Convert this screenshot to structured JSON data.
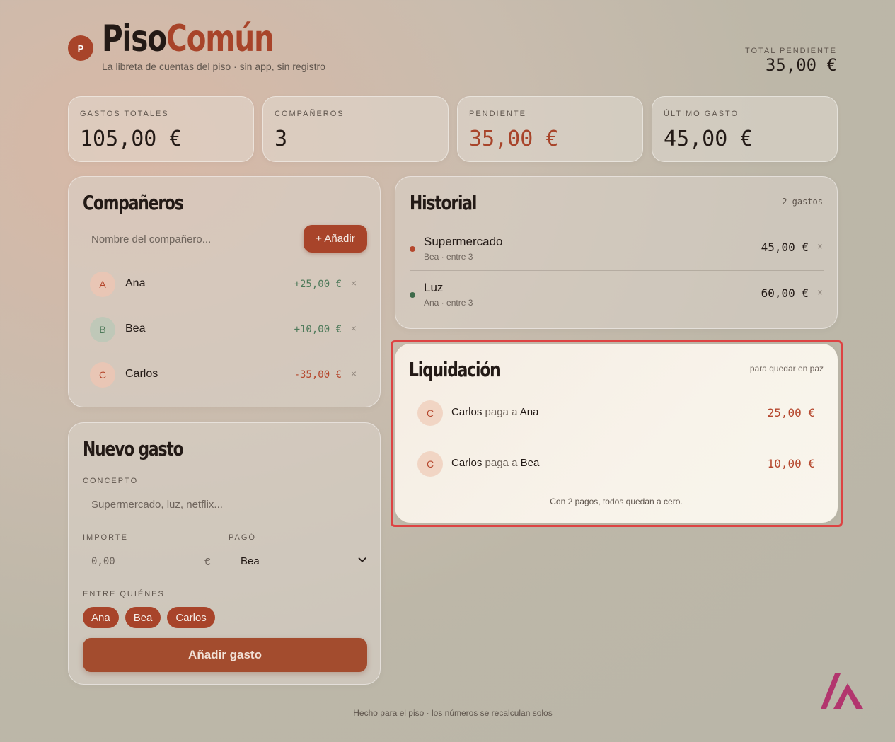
{
  "brand": {
    "part1": "Piso",
    "part2": "Común",
    "badge": "P",
    "tagline": "La libreta de cuentas del piso · sin app, sin registro"
  },
  "header_total": {
    "label": "TOTAL PENDIENTE",
    "value": "35,00 €"
  },
  "stats": [
    {
      "label": "GASTOS TOTALES",
      "value": "105,00 €"
    },
    {
      "label": "COMPAÑEROS",
      "value": "3"
    },
    {
      "label": "PENDIENTE",
      "value": "35,00 €"
    },
    {
      "label": "ÚLTIMO GASTO",
      "value": "45,00 €"
    }
  ],
  "companions": {
    "title": "Compañeros",
    "input_placeholder": "Nombre del compañero...",
    "add_label": "+ Añadir",
    "members": [
      {
        "initial": "A",
        "name": "Ana",
        "balance": "+25,00 €"
      },
      {
        "initial": "B",
        "name": "Bea",
        "balance": "+10,00 €"
      },
      {
        "initial": "C",
        "name": "Carlos",
        "balance": "-35,00 €"
      }
    ],
    "remove_glyph": "×"
  },
  "new_expense": {
    "title": "Nuevo gasto",
    "concept_label": "CONCEPTO",
    "concept_placeholder": "Supermercado, luz, netflix...",
    "amount_label": "IMPORTE",
    "amount_placeholder": "0,00",
    "currency": "€",
    "payer_label": "PAGÓ",
    "payer_value": "Bea",
    "split_label": "ENTRE QUIÉNES",
    "split_chips": [
      "Ana",
      "Bea",
      "Carlos"
    ],
    "submit_label": "Añadir gasto"
  },
  "history": {
    "title": "Historial",
    "count": "2 gastos",
    "items": [
      {
        "title": "Supermercado",
        "sub": "Bea · entre 3",
        "amount": "45,00 €",
        "dot_color": "#b5472d"
      },
      {
        "title": "Luz",
        "sub": "Ana · entre 3",
        "amount": "60,00 €",
        "dot_color": "#3f6b4b"
      }
    ],
    "remove_glyph": "×"
  },
  "settlement": {
    "title": "Liquidación",
    "subtitle": "para quedar en paz",
    "payments": [
      {
        "initial": "C",
        "from": "Carlos",
        "verb": "paga a",
        "to": "Ana",
        "amount": "25,00 €"
      },
      {
        "initial": "C",
        "from": "Carlos",
        "verb": "paga a",
        "to": "Bea",
        "amount": "10,00 €"
      }
    ],
    "footer": "Con 2 pagos, todos quedan a cero."
  },
  "footer": "Hecho para el piso · los números se recalculan solos",
  "colors": {
    "accent": "#a8442a",
    "positive": "#4e7a5a",
    "negative": "#b5472d",
    "highlight": "#dd4343"
  }
}
